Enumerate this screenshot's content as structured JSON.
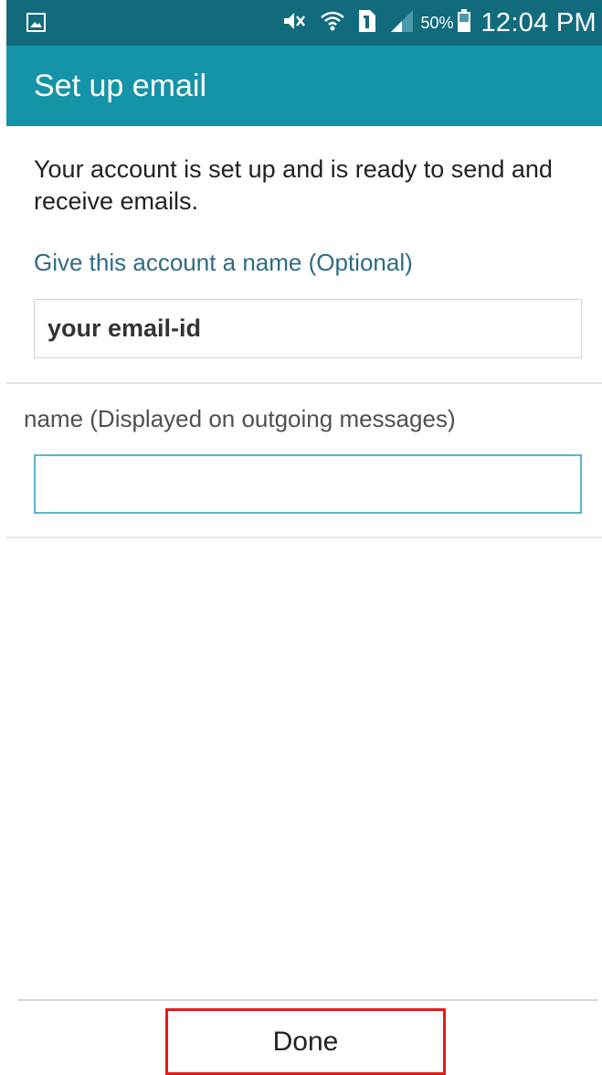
{
  "status_bar": {
    "battery_percent": "50%",
    "time": "12:04 PM",
    "icons": [
      "gallery-icon",
      "mute-icon",
      "wifi-icon",
      "sim-icon",
      "signal-icon",
      "battery-icon"
    ]
  },
  "header": {
    "title": "Set up email"
  },
  "main": {
    "message": "Your account is set up and is ready to send and receive emails.",
    "account_name": {
      "label": "Give this account a name (Optional)",
      "value": "your email-id"
    },
    "your_name": {
      "label": "name (Displayed on outgoing messages)",
      "value": ""
    }
  },
  "footer": {
    "done_label": "Done"
  },
  "colors": {
    "status_bar": "#126b7d",
    "action_bar": "#1593a7",
    "label_accent": "#2f6b83",
    "focused_input_border": "#5fb3c7",
    "highlight": "#e31b1b"
  }
}
